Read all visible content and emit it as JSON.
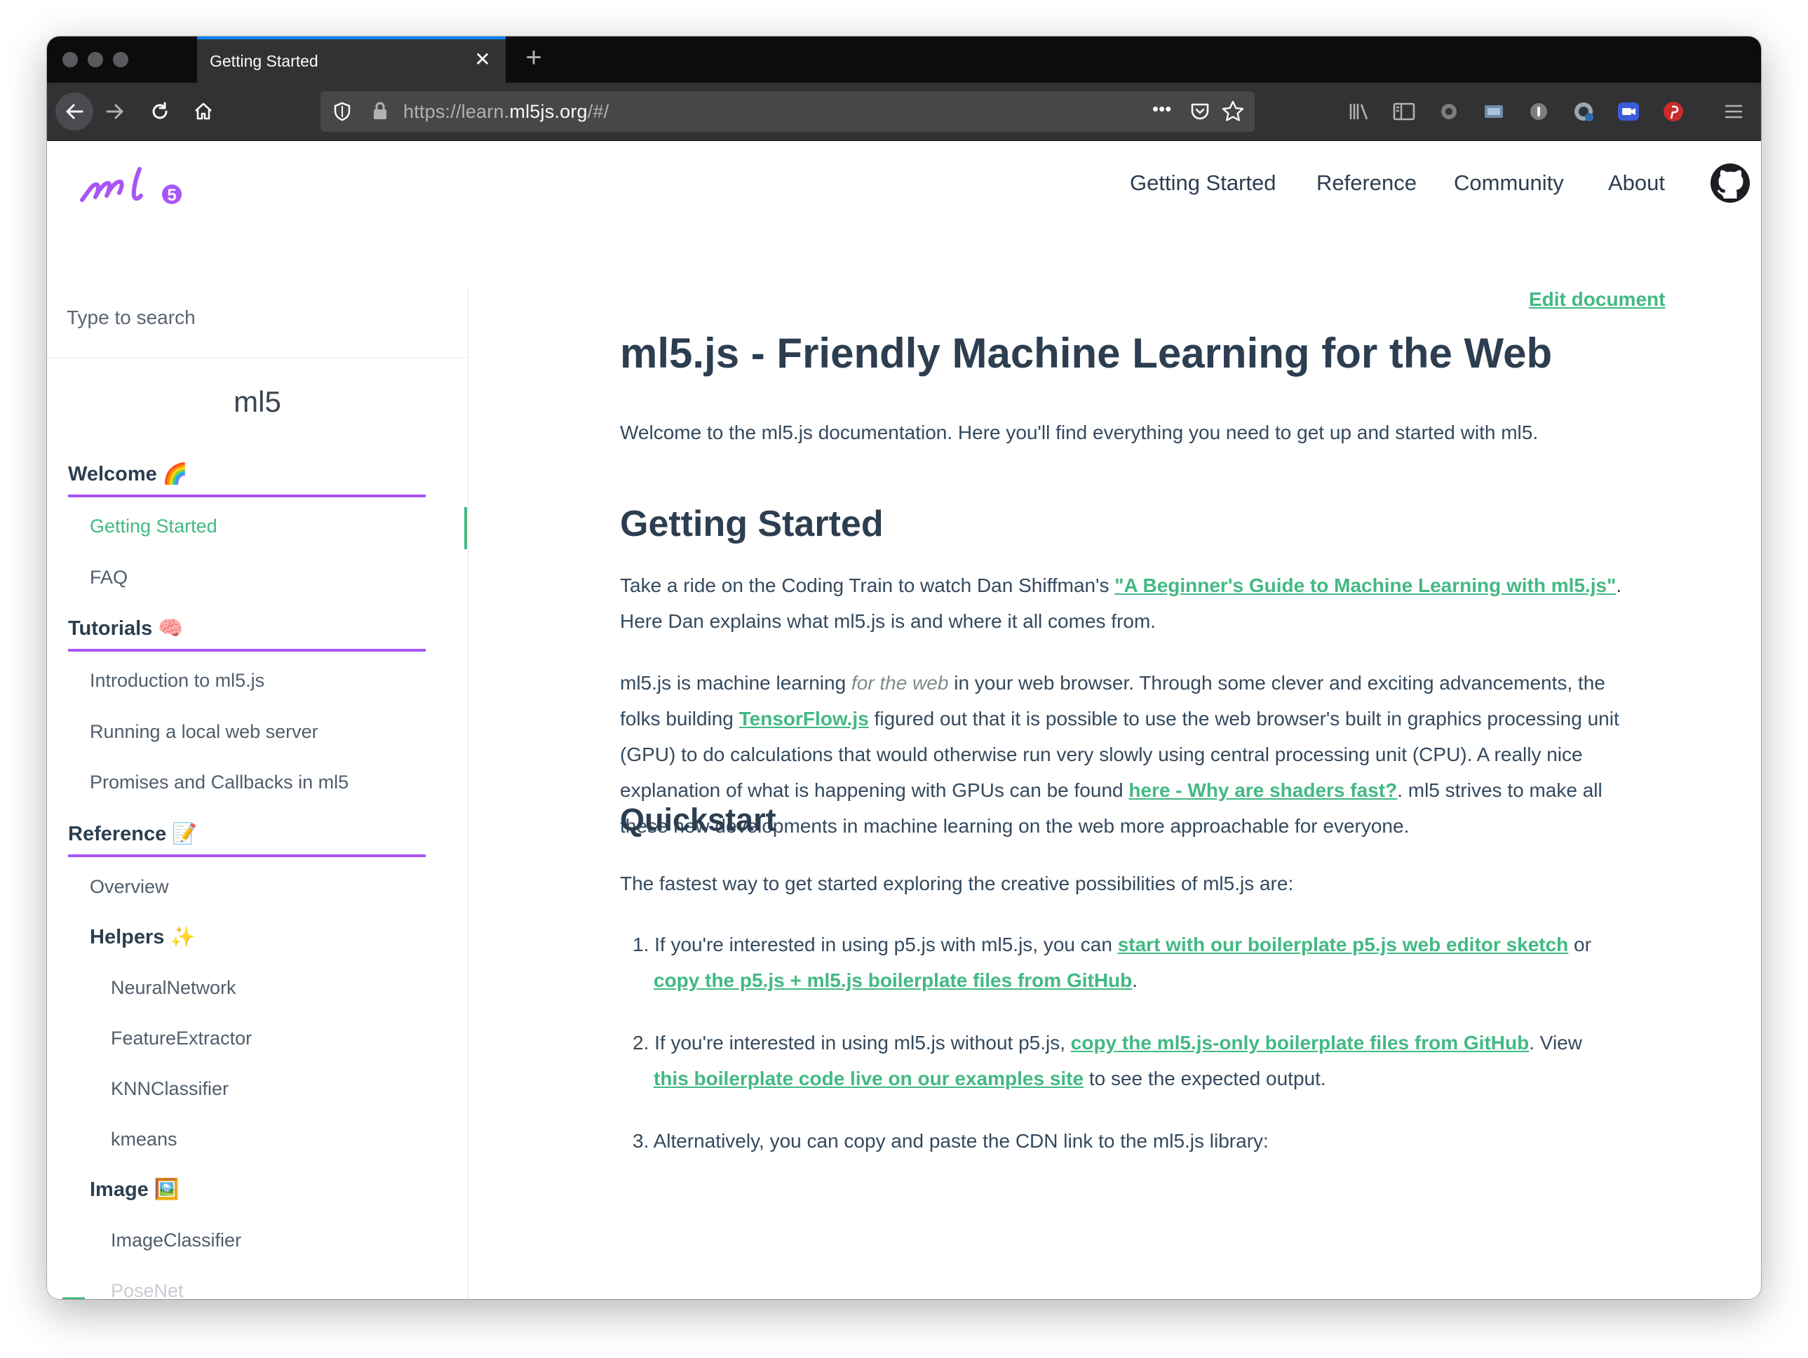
{
  "browser": {
    "tab_title": "Getting Started",
    "tab_close": "✕",
    "new_tab": "+",
    "url_prefix": "https://learn.",
    "url_host": "ml5js.org",
    "url_suffix": "/#/",
    "url_overflow": "•••"
  },
  "site": {
    "logo": "ml5",
    "nav": [
      "Getting Started",
      "Reference",
      "Community",
      "About"
    ]
  },
  "sidebar": {
    "search_placeholder": "Type to search",
    "app_name": "ml5",
    "sections": {
      "welcome": "Welcome 🌈",
      "tutorials": "Tutorials 🧠",
      "reference": "Reference 📝"
    },
    "welcome_items": [
      "Getting Started",
      "FAQ"
    ],
    "tutorial_items": [
      "Introduction to ml5.js",
      "Running a local web server",
      "Promises and Callbacks in ml5"
    ],
    "reference_items": {
      "overview": "Overview",
      "helpers": "Helpers ✨",
      "helper_items": [
        "NeuralNetwork",
        "FeatureExtractor",
        "KNNClassifier",
        "kmeans"
      ],
      "image": "Image 🖼️",
      "image_items": [
        "ImageClassifier",
        "PoseNet"
      ]
    }
  },
  "content": {
    "edit_link": "Edit document",
    "title": "ml5.js - Friendly Machine Learning for the Web",
    "intro": "Welcome to the ml5.js documentation. Here you'll find everything you need to get up and started with ml5.",
    "h_getting_started": "Getting Started",
    "p1_a": "Take a ride on the Coding Train to watch Dan Shiffman's ",
    "p1_link": "\"A Beginner's Guide to Machine Learning with ml5.js\"",
    "p1_b": ". Here Dan explains what ml5.js is and where it all comes from.",
    "p2_a": "ml5.js is machine learning ",
    "p2_em": "for the web",
    "p2_b": " in your web browser. Through some clever and exciting advancements, the folks building ",
    "p2_link1": "TensorFlow.js",
    "p2_c": " figured out that it is possible to use the web browser's built in graphics processing unit (GPU) to do calculations that would otherwise run very slowly using central processing unit (CPU). A really nice explanation of what is happening with GPUs can be found ",
    "p2_link2": "here - Why are shaders fast?",
    "p2_d": ". ml5 strives to make all these new developments in machine learning on the web more approachable for everyone.",
    "h_quickstart": "Quickstart",
    "qs_intro": "The fastest way to get started exploring the creative possibilities of ml5.js are:",
    "li1_num": "1.",
    "li1_a": "If you're interested in using p5.js with ml5.js, you can ",
    "li1_link1": "start with our boilerplate p5.js web editor sketch",
    "li1_b": " or ",
    "li1_link2": "copy the p5.js + ml5.js boilerplate files from GitHub",
    "li1_c": ".",
    "li2_num": "2.",
    "li2_a": "If you're interested in using ml5.js without p5.js, ",
    "li2_link1": "copy the ml5.js-only boilerplate files from GitHub",
    "li2_b": ". View ",
    "li2_link2": "this boilerplate code live on our examples site",
    "li2_c": " to see the expected output.",
    "li3_num": "3.",
    "li3_a": "Alternatively, you can copy and paste the CDN link to the ml5.js library:"
  },
  "colors": {
    "accent_green": "#42b983",
    "section_purple": "#a855f7",
    "text_dark": "#2c3e50"
  }
}
